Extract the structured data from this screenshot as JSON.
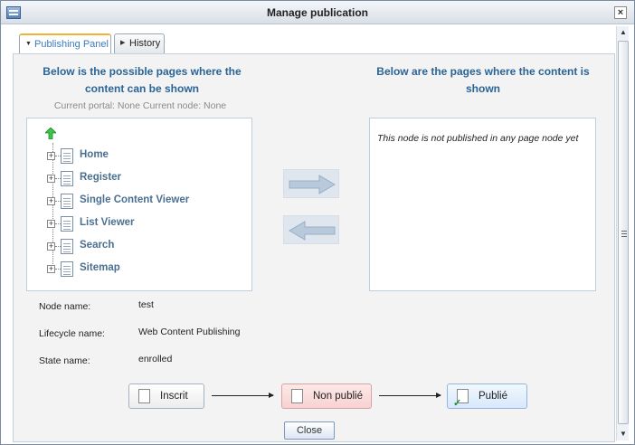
{
  "window": {
    "title": "Manage publication",
    "close_glyph": "×",
    "icon": "window-icon"
  },
  "tabs": [
    {
      "label": "Publishing Panel",
      "active": true,
      "caret": "▼"
    },
    {
      "label": "History",
      "active": false,
      "caret": "▶"
    }
  ],
  "left_heading": "Below is the possible pages where the content can be shown",
  "right_heading": "Below are the pages where the content is shown",
  "current_info": "Current portal: None Current node: None",
  "tree": {
    "up_icon": "up-arrow-icon",
    "items": [
      {
        "label": "Home",
        "expander": "+"
      },
      {
        "label": "Register",
        "expander": "+"
      },
      {
        "label": "Single Content Viewer",
        "expander": "+"
      },
      {
        "label": "List Viewer",
        "expander": "+"
      },
      {
        "label": "Search",
        "expander": "+"
      },
      {
        "label": "Sitemap",
        "expander": "+"
      }
    ]
  },
  "move_right_icon": "arrow-right-icon",
  "move_left_icon": "arrow-left-icon",
  "published_message": "This node is not published in any page node yet",
  "info": {
    "node_name_label": "Node name:",
    "node_name": "test",
    "lifecycle_label": "Lifecycle name:",
    "lifecycle": "Web Content Publishing",
    "state_label": "State name:",
    "state": "enrolled"
  },
  "lifecycle_states": [
    {
      "label": "Inscrit",
      "icon": "document-icon"
    },
    {
      "label": "Non publié",
      "icon": "document-minus-icon"
    },
    {
      "label": "Publié",
      "icon": "document-check-icon"
    }
  ],
  "close_label": "Close",
  "colors": {
    "heading": "#2a6496",
    "tab_active_border": "#f2b233",
    "tree_label": "#4b6f91"
  }
}
